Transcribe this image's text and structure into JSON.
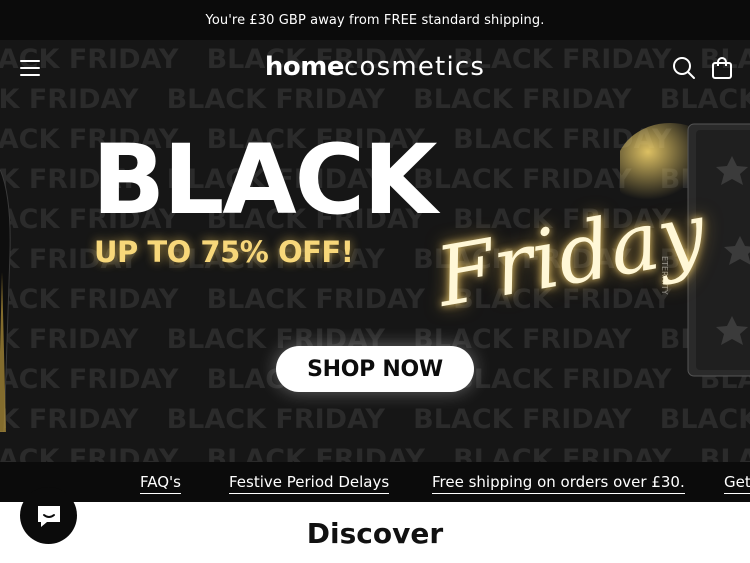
{
  "announcement": {
    "text": "You're £30 GBP away from FREE standard shipping."
  },
  "header": {
    "logo_part1": "home",
    "logo_part2": "cosmetics",
    "icons": [
      "menu-icon",
      "search-icon",
      "bag-icon"
    ]
  },
  "hero": {
    "background_word": "BLACK FRIDAY",
    "headline": "BLACK",
    "offer": "UP TO 75% OFF!",
    "script_word": "Friday",
    "cta_label": "SHOP NOW",
    "product_brand": "ETERNITY",
    "accent_color": "#f7d77a"
  },
  "links": [
    {
      "label": "FAQ's"
    },
    {
      "label": "Festive Period Delays"
    },
    {
      "label": "Free shipping on orders over £30."
    },
    {
      "label": "Get"
    }
  ],
  "chat": {
    "icon": "chat-icon"
  },
  "section": {
    "title": "Discover"
  }
}
